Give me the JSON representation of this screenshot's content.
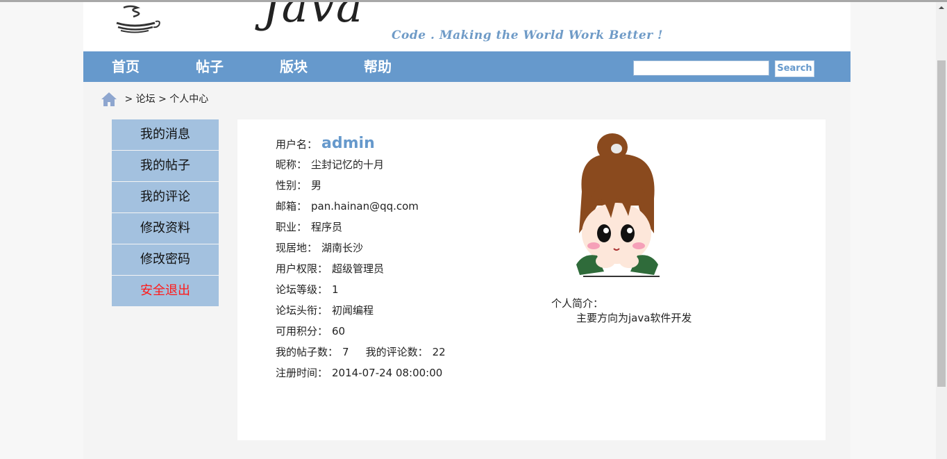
{
  "header": {
    "logo_word": "Java",
    "slogan": "Code . Making the World Work Better !"
  },
  "nav": {
    "items": [
      {
        "label": "首页"
      },
      {
        "label": "帖子"
      },
      {
        "label": "版块"
      },
      {
        "label": "帮助"
      }
    ],
    "search": {
      "value": "",
      "placeholder": "",
      "button_label": "Search"
    }
  },
  "breadcrumb": {
    "sep1": ">",
    "level1": "论坛",
    "sep2": ">",
    "level2": "个人中心"
  },
  "sidebar": {
    "items": [
      {
        "label": "我的消息"
      },
      {
        "label": "我的帖子"
      },
      {
        "label": "我的评论"
      },
      {
        "label": "修改资料"
      },
      {
        "label": "修改密码"
      },
      {
        "label": "安全退出"
      }
    ]
  },
  "profile": {
    "username_label": "用户名：",
    "username": "admin",
    "nickname_label": "昵称：",
    "nickname": "尘封记忆的十月",
    "gender_label": "性别：",
    "gender": "男",
    "email_label": "邮箱：",
    "email": "pan.hainan@qq.com",
    "job_label": "职业：",
    "job": "程序员",
    "location_label": "现居地：",
    "location": "湖南长沙",
    "role_label": "用户权限：",
    "role": "超级管理员",
    "level_label": "论坛等级：",
    "level": "1",
    "title_label": "论坛头衔：",
    "title": "初闻编程",
    "points_label": "可用积分：",
    "points": "60",
    "posts_label": "我的帖子数：",
    "posts": "7",
    "comments_label": "我的评论数：",
    "comments": "22",
    "registered_label": "注册时间：",
    "registered": "2014-07-24 08:00:00",
    "bio_label": "个人简介：",
    "bio": "主要方向为java软件开发"
  },
  "colors": {
    "nav_bg": "#6699cc",
    "side_bg": "#a3c1df",
    "logout": "#ff1a1a",
    "username": "#6699cc"
  }
}
